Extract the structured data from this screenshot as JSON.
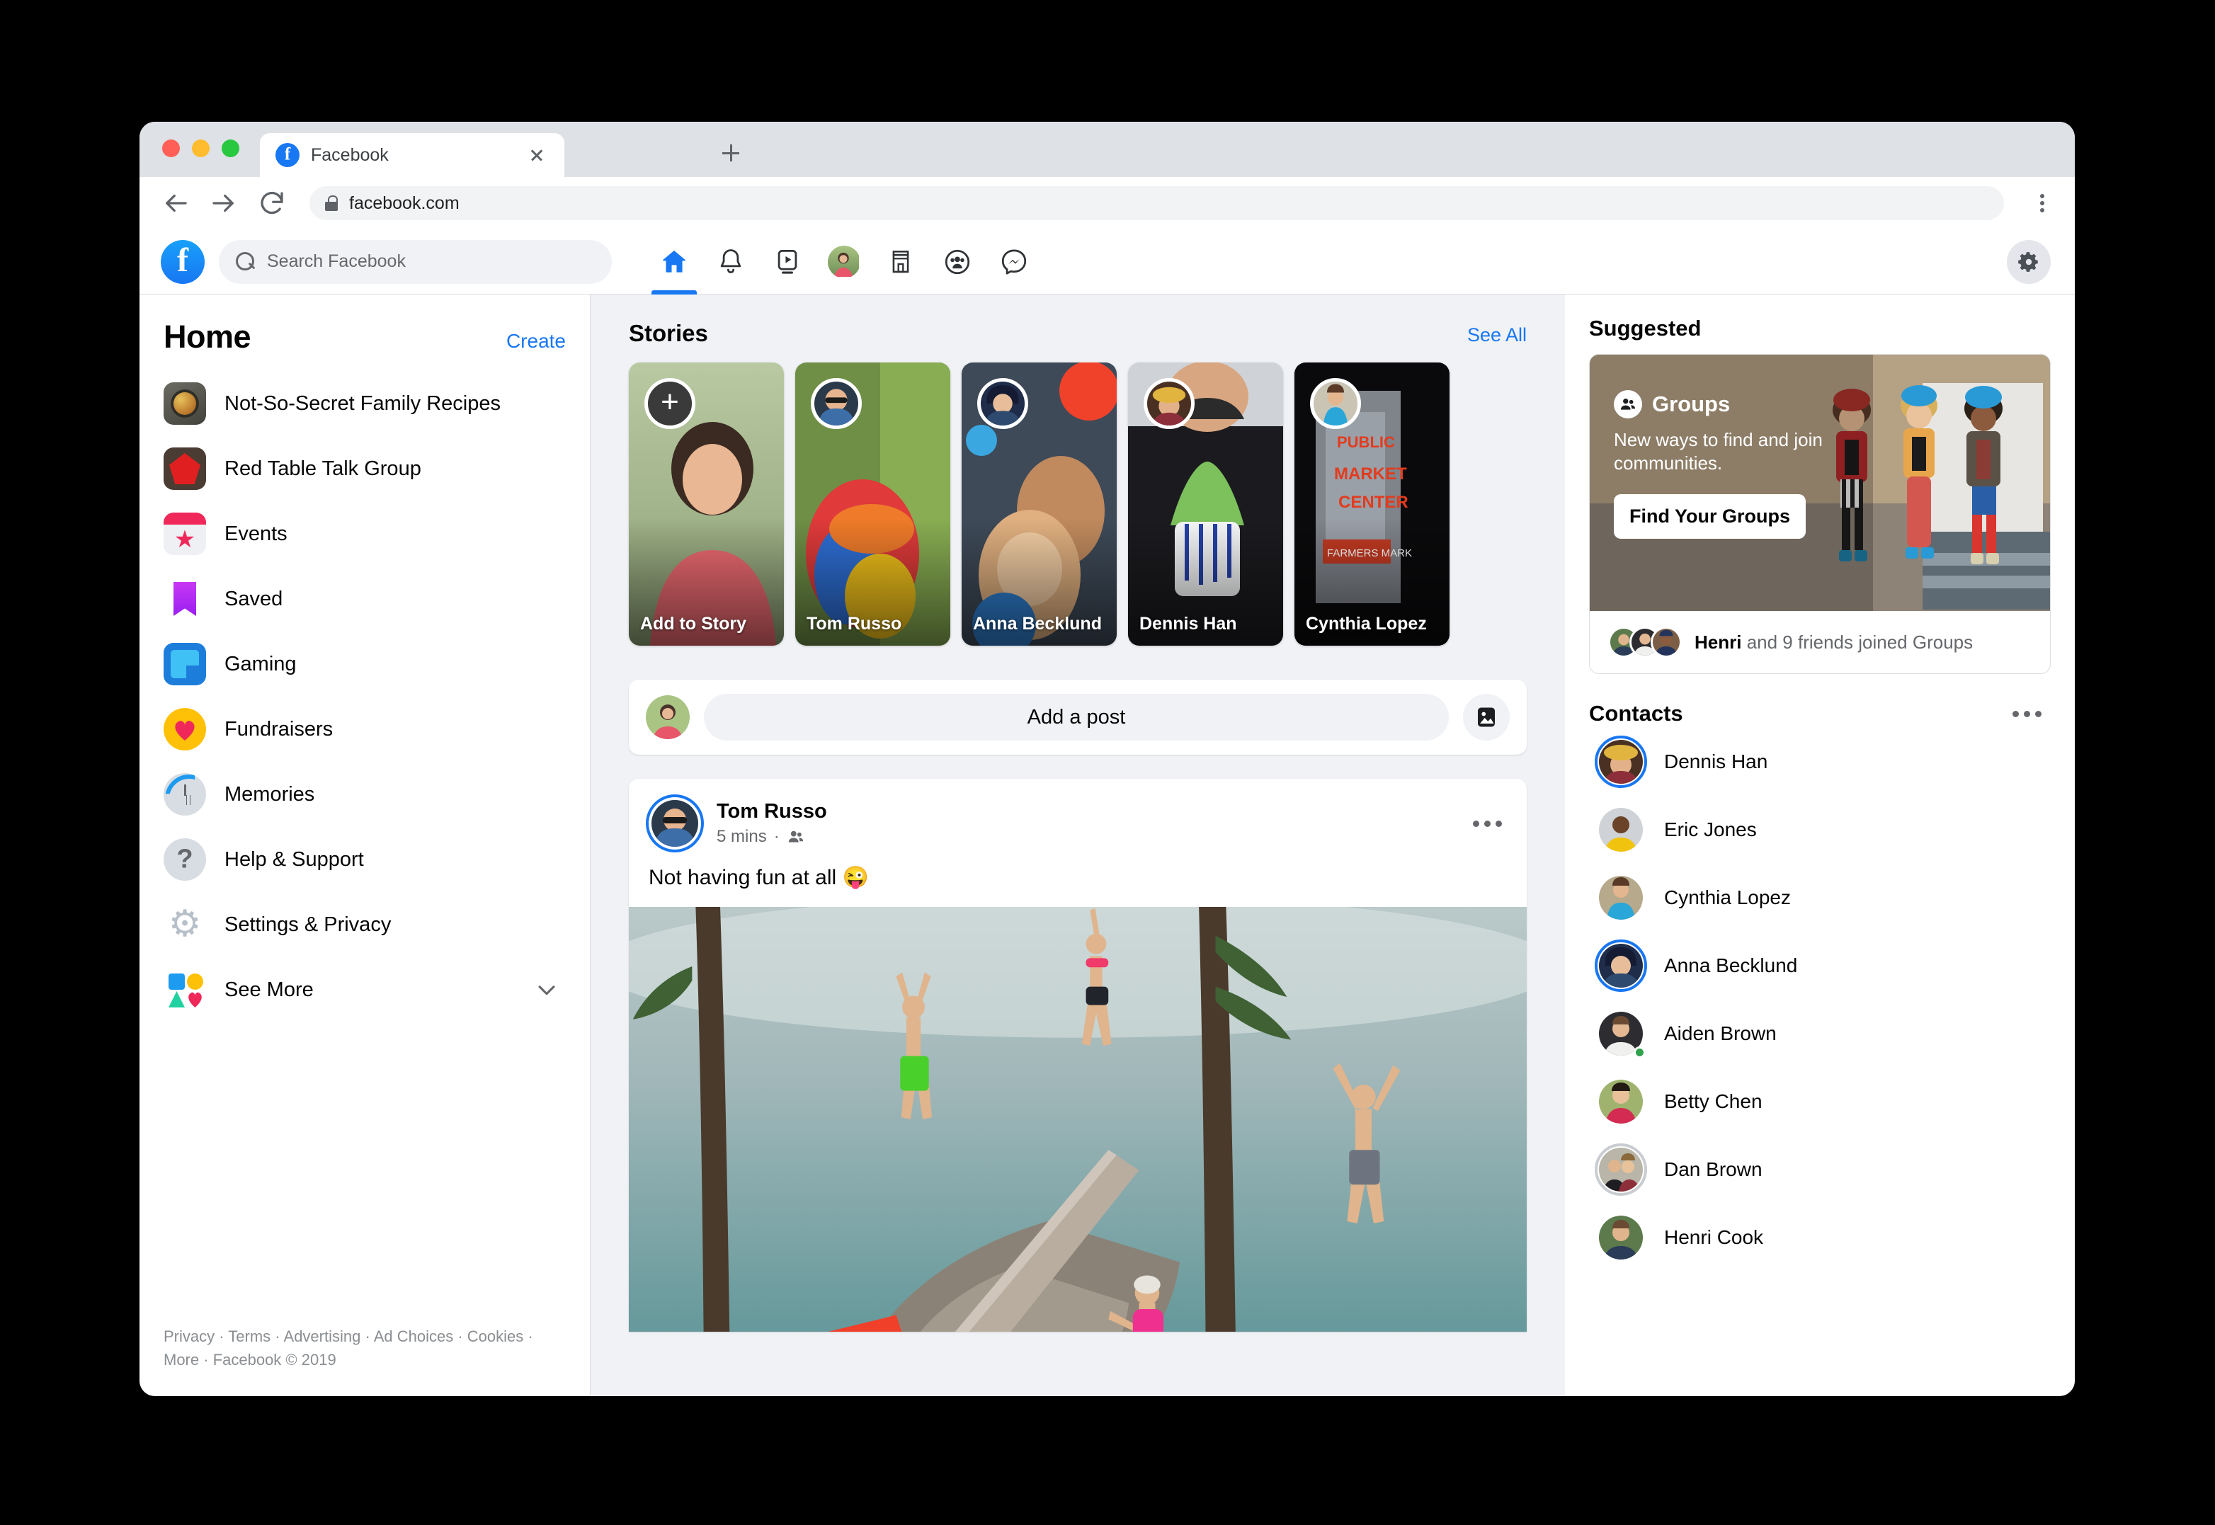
{
  "browser": {
    "tab_title": "Facebook",
    "url": "facebook.com",
    "new_tab_label": "+",
    "back_label": "Back",
    "forward_label": "Forward",
    "reload_label": "Reload"
  },
  "topnav": {
    "search_placeholder": "Search Facebook",
    "brand": "f",
    "tabs": [
      {
        "name": "home",
        "icon": "home-icon",
        "active": true
      },
      {
        "name": "notifications",
        "icon": "bell-icon",
        "active": false
      },
      {
        "name": "watch",
        "icon": "watch-video-icon",
        "active": false
      },
      {
        "name": "profile",
        "icon": "profile-avatar",
        "active": false
      },
      {
        "name": "marketplace",
        "icon": "marketplace-store-icon",
        "active": false
      },
      {
        "name": "groups",
        "icon": "groups-icon",
        "active": false
      },
      {
        "name": "messenger",
        "icon": "messenger-icon",
        "active": false
      }
    ],
    "settings_icon": "gear-icon"
  },
  "sidebar": {
    "title": "Home",
    "create_label": "Create",
    "items": [
      {
        "label": "Not-So-Secret Family Recipes",
        "icon": "group-photo-recipes-icon"
      },
      {
        "label": "Red Table Talk Group",
        "icon": "group-photo-redtable-icon"
      },
      {
        "label": "Events",
        "icon": "events-calendar-icon"
      },
      {
        "label": "Saved",
        "icon": "saved-bookmark-icon"
      },
      {
        "label": "Gaming",
        "icon": "gaming-controller-icon"
      },
      {
        "label": "Fundraisers",
        "icon": "fundraisers-heart-icon"
      },
      {
        "label": "Memories",
        "icon": "memories-clock-icon"
      },
      {
        "label": "Help & Support",
        "icon": "help-question-icon"
      },
      {
        "label": "Settings & Privacy",
        "icon": "settings-gear-icon"
      },
      {
        "label": "See More",
        "icon": "see-more-shapes-icon"
      }
    ],
    "footer_links": [
      "Privacy",
      "Terms",
      "Advertising",
      "Ad Choices",
      "Cookies",
      "More"
    ],
    "footer_copyright": "Facebook © 2019",
    "footer_separator": " · "
  },
  "stories": {
    "title": "Stories",
    "see_all_label": "See All",
    "cards": [
      {
        "name": "Add to Story",
        "type": "add"
      },
      {
        "name": "Tom Russo",
        "type": "story"
      },
      {
        "name": "Anna Becklund",
        "type": "story"
      },
      {
        "name": "Dennis Han",
        "type": "story"
      },
      {
        "name": "Cynthia Lopez",
        "type": "story"
      }
    ]
  },
  "composer": {
    "placeholder": "Add a post",
    "photo_icon": "photo-icon"
  },
  "post": {
    "author": "Tom Russo",
    "time": "5 mins",
    "audience_icon": "friends-icon",
    "menu_icon": "more-options-icon",
    "text": "Not having fun at all 😜"
  },
  "suggested": {
    "title": "Suggested",
    "brand": "Groups",
    "brand_icon": "groups-icon",
    "subtitle": "New ways to find and join communities.",
    "button_label": "Find Your Groups",
    "footer_strong": "Henri",
    "footer_rest": " and 9 friends joined Groups"
  },
  "contacts": {
    "title": "Contacts",
    "menu_icon": "more-options-icon",
    "items": [
      {
        "name": "Dennis Han",
        "ring": "blue",
        "online": false
      },
      {
        "name": "Eric Jones",
        "ring": "none",
        "online": false
      },
      {
        "name": "Cynthia Lopez",
        "ring": "none",
        "online": false
      },
      {
        "name": "Anna Becklund",
        "ring": "blue",
        "online": false
      },
      {
        "name": "Aiden Brown",
        "ring": "none",
        "online": true
      },
      {
        "name": "Betty Chen",
        "ring": "none",
        "online": false
      },
      {
        "name": "Dan Brown",
        "ring": "gray",
        "online": false
      },
      {
        "name": "Henri Cook",
        "ring": "none",
        "online": false
      }
    ]
  },
  "colors": {
    "accent": "#1877f2",
    "feed_bg": "#f0f2f5",
    "text": "#050505",
    "muted": "#65676b",
    "online": "#31a24c"
  }
}
